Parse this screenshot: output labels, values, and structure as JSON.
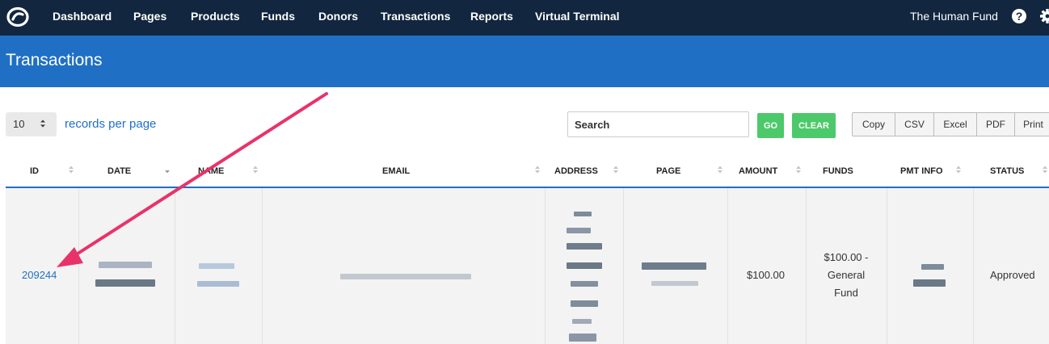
{
  "nav": {
    "items": [
      "Dashboard",
      "Pages",
      "Products",
      "Funds",
      "Donors",
      "Transactions",
      "Reports",
      "Virtual Terminal"
    ],
    "org_name": "The Human Fund",
    "help_glyph": "?"
  },
  "header": {
    "title": "Transactions"
  },
  "controls": {
    "per_page_value": "10",
    "per_page_label": "records per page",
    "search_placeholder": "Search",
    "go_label": "GO",
    "clear_label": "CLEAR",
    "export_buttons": [
      "Copy",
      "CSV",
      "Excel",
      "PDF",
      "Print"
    ]
  },
  "table": {
    "columns": [
      "ID",
      "DATE",
      "NAME",
      "EMAIL",
      "ADDRESS",
      "PAGE",
      "AMOUNT",
      "FUNDS",
      "PMT INFO",
      "STATUS"
    ],
    "row": {
      "id": "209244",
      "amount": "$100.00",
      "funds_lines": [
        "$100.00 -",
        "General",
        "Fund"
      ],
      "status": "Approved"
    }
  },
  "colors": {
    "nav_bg": "#12263f",
    "header_bg": "#1f6fc5",
    "accent_green": "#4cc96a",
    "annotation_arrow": "#e8336a"
  }
}
